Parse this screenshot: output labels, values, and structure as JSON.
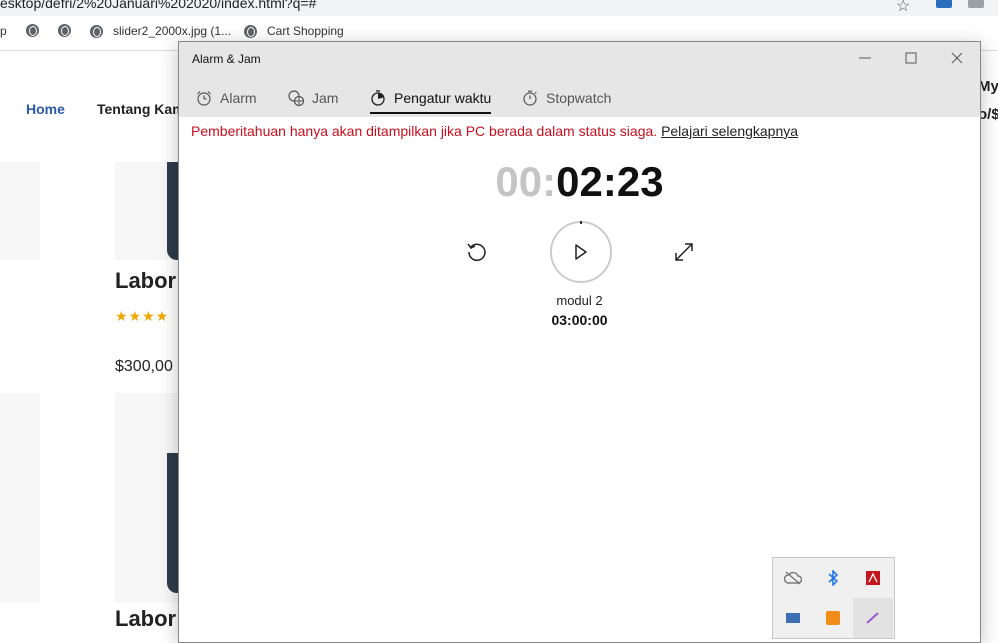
{
  "browser": {
    "url": "esktop/defri/2%20Januari%202020/index.html?q=#",
    "bookmarks": [
      "p",
      "",
      "",
      "slider2_2000x.jpg (1...",
      "Cart Shopping"
    ]
  },
  "site": {
    "nav_home": "Home",
    "nav_about": "Tentang Kam",
    "right_text_1": "My",
    "right_text_2": "o/$c",
    "product_title_1": "Labor",
    "product_title_2": "Labor",
    "rating": "★★★★",
    "price": "$300,00"
  },
  "app": {
    "title": "Alarm & Jam",
    "tabs": [
      {
        "label": "Alarm",
        "icon": "alarm-clock-icon"
      },
      {
        "label": "Jam",
        "icon": "world-clock-icon"
      },
      {
        "label": "Pengatur waktu",
        "icon": "timer-icon"
      },
      {
        "label": "Stopwatch",
        "icon": "stopwatch-icon"
      }
    ],
    "active_tab": "Pengatur waktu",
    "notice_text": "Pemberitahuan hanya akan ditampilkan jika PC berada dalam status siaga.",
    "notice_link": "Pelajari selengkapnya",
    "timer": {
      "hours": "00",
      "sep": ":",
      "remaining": "02:23",
      "name": "modul 2",
      "total": "03:00:00"
    }
  },
  "tray": {
    "icons": [
      "cloud-offline-icon",
      "bluetooth-icon",
      "adobe-icon",
      "network-icon",
      "sublime-icon",
      "pen-icon"
    ]
  },
  "colors": {
    "accent_red": "#c50f1f",
    "nav_blue": "#2a5aa8",
    "titlebar": "#e6e6e6"
  }
}
